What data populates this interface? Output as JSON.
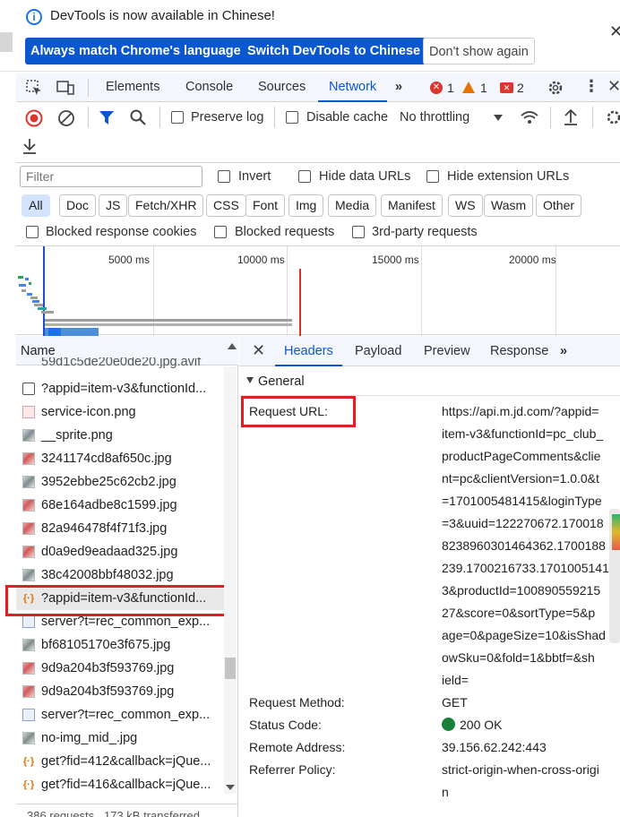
{
  "banner": {
    "message": "DevTools is now available in Chinese!",
    "btn_match": "Always match Chrome's language",
    "btn_switch": "Switch DevTools to Chinese",
    "btn_dismiss": "Don't show again",
    "close": "✕"
  },
  "tabs": [
    "Elements",
    "Console",
    "Sources",
    "Network"
  ],
  "active_tab": "Network",
  "issues": {
    "errors": "1",
    "warnings": "1",
    "info": "2"
  },
  "toolbar": {
    "preserve_log": "Preserve log",
    "disable_cache": "Disable cache",
    "throttling": "No throttling"
  },
  "filter": {
    "placeholder": "Filter",
    "invert": "Invert",
    "hide_data_urls": "Hide data URLs",
    "hide_ext_urls": "Hide extension URLs",
    "chips": [
      "All",
      "Doc",
      "JS",
      "Fetch/XHR",
      "CSS",
      "Font",
      "Img",
      "Media",
      "Manifest",
      "WS",
      "Wasm",
      "Other"
    ],
    "blocked_cookies": "Blocked response cookies",
    "blocked_requests": "Blocked requests",
    "third_party": "3rd-party requests"
  },
  "timeline": {
    "ticks": [
      "5000 ms",
      "10000 ms",
      "15000 ms",
      "20000 ms"
    ]
  },
  "name_col": {
    "header": "Name",
    "rows": [
      "59d1c5de20e0de20.jpg.avif",
      "?appid=item-v3&functionId...",
      "service-icon.png",
      "__sprite.png",
      "3241174cd8af650c.jpg",
      "3952ebbe25c62cb2.jpg",
      "68e164adbe8c1599.jpg",
      "82a946478f4f71f3.jpg",
      "d0a9ed9eadaad325.jpg",
      "38c42008bbf48032.jpg",
      "?appid=item-v3&functionId...",
      "server?t=rec_common_exp...",
      "bf68105170e3f675.jpg",
      "9d9a204b3f593769.jpg",
      "9d9a204b3f593769.jpg",
      "server?t=rec_common_exp...",
      "no-img_mid_.jpg",
      "get?fid=412&callback=jQue...",
      "get?fid=416&callback=jQue..."
    ],
    "footer": "386 requests   173 kB transferred"
  },
  "detail": {
    "close": "✕",
    "tabs": [
      "Headers",
      "Payload",
      "Preview",
      "Response"
    ],
    "active_tab": "Headers",
    "section": "General",
    "request_url_label": "Request URL:",
    "request_url_lines": [
      "https://api.m.jd.com/?appid=",
      "item-v3&functionId=pc_club_",
      "productPageComments&clie",
      "nt=pc&clientVersion=1.0.0&t",
      "=1701005481415&loginType",
      "=3&uuid=122270672.170018",
      "8238960301464362.1700188",
      "239.1700216733.1701005141",
      "3&productId=100890559215",
      "27&score=0&sortType=5&p",
      "age=0&pageSize=10&isShad",
      "owSku=0&fold=1&bbtf=&sh",
      "ield="
    ],
    "request_method_label": "Request Method:",
    "request_method": "GET",
    "status_code_label": "Status Code:",
    "status_code": "200 OK",
    "remote_address_label": "Remote Address:",
    "remote_address": "39.156.62.242:443",
    "referrer_policy_label": "Referrer Policy:",
    "referrer_policy_lines": [
      "strict-origin-when-cross-origi",
      "n"
    ]
  },
  "colors": {
    "accent": "#0b57d0",
    "error": "#dc362e",
    "warning": "#e37400",
    "status_ok": "#188038",
    "highlight_box": "#e02020"
  }
}
